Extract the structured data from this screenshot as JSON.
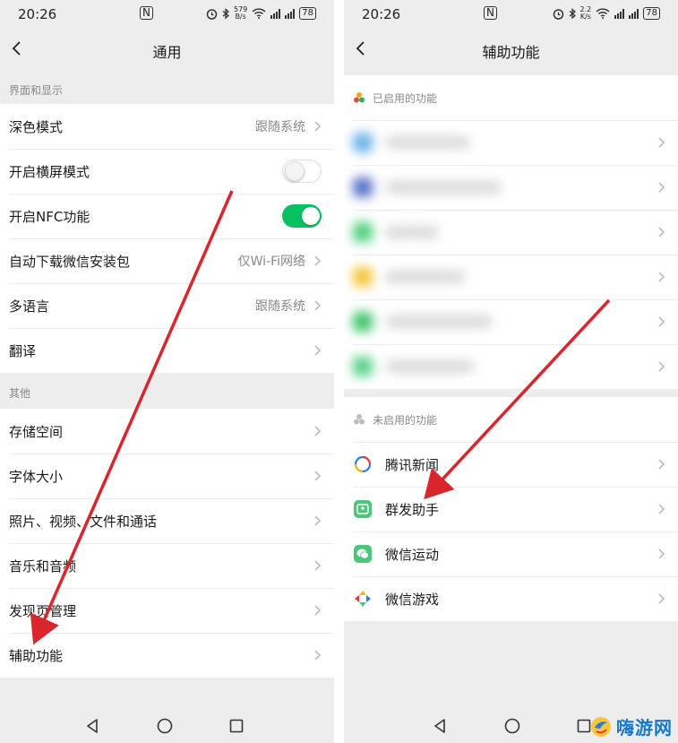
{
  "colors": {
    "accent_green": "#07c160",
    "annotation_red": "#d8262c",
    "watermark_blue": "#1577c7"
  },
  "left_screen": {
    "status": {
      "time": "20:26",
      "nfc": "N",
      "speed_top": "579",
      "speed_bottom": "B/s",
      "battery": "78"
    },
    "title": "通用",
    "sections": [
      {
        "header": "界面和显示",
        "rows": [
          {
            "label": "深色模式",
            "value": "跟随系统"
          },
          {
            "label": "开启横屏模式",
            "toggle": "off"
          },
          {
            "label": "开启NFC功能",
            "toggle": "on"
          },
          {
            "label": "自动下载微信安装包",
            "value": "仅Wi-Fi网络"
          },
          {
            "label": "多语言",
            "value": "跟随系统"
          },
          {
            "label": "翻译",
            "value": ""
          }
        ]
      },
      {
        "header": "其他",
        "rows": [
          {
            "label": "存储空间"
          },
          {
            "label": "字体大小"
          },
          {
            "label": "照片、视频、文件和通话"
          },
          {
            "label": "音乐和音频"
          },
          {
            "label": "发现页管理"
          },
          {
            "label": "辅助功能"
          }
        ]
      }
    ]
  },
  "right_screen": {
    "status": {
      "time": "20:26",
      "nfc": "N",
      "speed_top": "2.2",
      "speed_bottom": "K/s",
      "battery": "78"
    },
    "title": "辅助功能",
    "enabled_header": "已启用的功能",
    "disabled_header": "未启用的功能",
    "disabled_features": [
      {
        "label": "腾讯新闻",
        "icon": "tencent-news-icon"
      },
      {
        "label": "群发助手",
        "icon": "group-send-icon"
      },
      {
        "label": "微信运动",
        "icon": "wechat-sport-icon"
      },
      {
        "label": "微信游戏",
        "icon": "wechat-game-icon"
      }
    ]
  },
  "watermark": {
    "text": "嗨游网"
  }
}
